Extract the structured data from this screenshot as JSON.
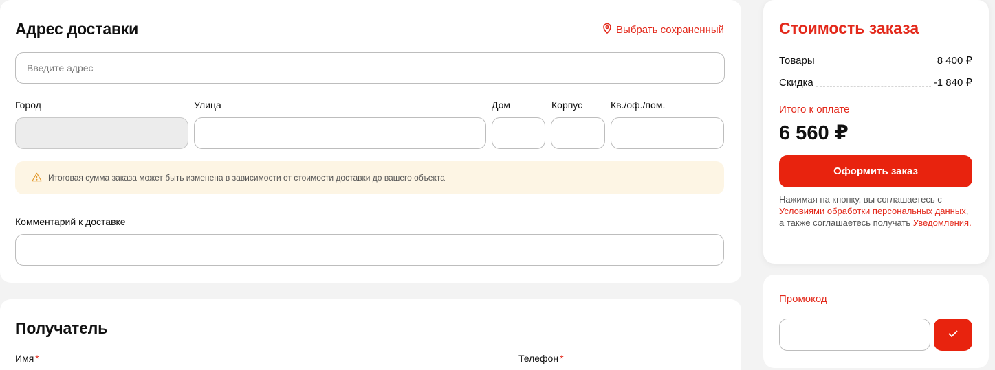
{
  "address": {
    "title": "Адрес доставки",
    "saved_link": "Выбрать сохраненный",
    "address_placeholder": "Введите адрес",
    "labels": {
      "city": "Город",
      "street": "Улица",
      "house": "Дом",
      "building": "Корпус",
      "apartment": "Кв./оф./пом."
    },
    "notice": "Итоговая сумма заказа может быть изменена в зависимости от стоимости доставки до вашего объекта",
    "comment_label": "Комментарий к доставке"
  },
  "recipient": {
    "title": "Получатель",
    "name_label": "Имя",
    "phone_label": "Телефон",
    "required_mark": "*"
  },
  "summary": {
    "title": "Стоимость заказа",
    "goods_label": "Товары",
    "goods_value": "8 400 ₽",
    "discount_label": "Скидка",
    "discount_value": "-1 840 ₽",
    "total_label": "Итого к оплате",
    "total_value": "6 560 ₽",
    "order_button": "Оформить заказ",
    "legal_1": "Нажимая на кнопку, вы соглашаетесь с ",
    "legal_link_1": "Условиями обработки персональных данных",
    "legal_2": ", а также соглашаетесь получать ",
    "legal_link_2": "Уведомления",
    "legal_3": "."
  },
  "promo": {
    "title": "Промокод",
    "placeholder": ""
  },
  "icons": {
    "saved_link": "map-pin-icon",
    "notice": "warning-icon",
    "promo_submit": "check-icon"
  },
  "colors": {
    "accent": "#e8230e",
    "accent_text": "#e3291b",
    "notice_bg": "#fdf5e4",
    "disabled_bg": "#ececec"
  }
}
